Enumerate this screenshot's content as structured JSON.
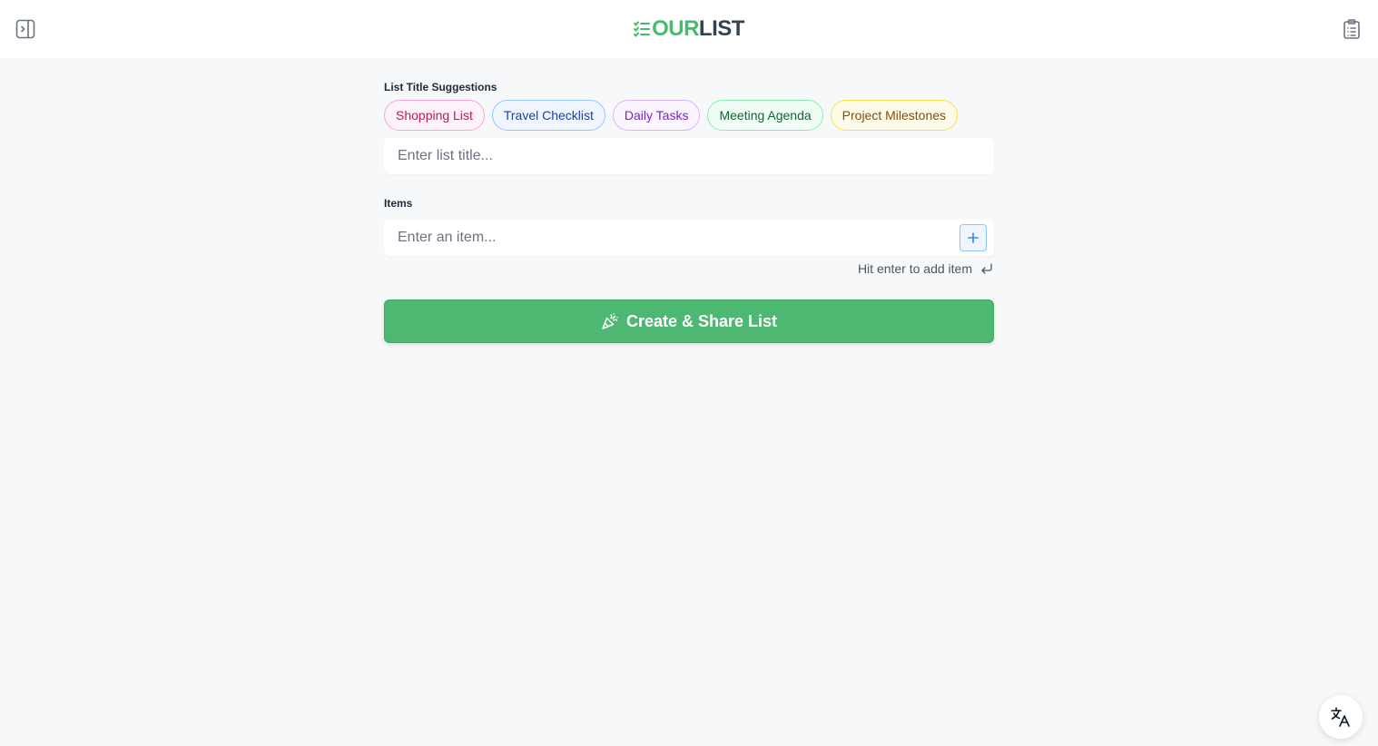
{
  "header": {
    "logo": {
      "part1": "OUR",
      "part2": "LIST",
      "mark_icon": "checklist-icon"
    },
    "left_icon": "sidebar-toggle-icon",
    "right_icon": "clipboard-list-icon"
  },
  "suggestions": {
    "label": "List Title Suggestions",
    "chips": [
      {
        "label": "Shopping List",
        "text_color": "#be185d",
        "bg": "#fdf2f8",
        "border": "#f9a8d4"
      },
      {
        "label": "Travel Checklist",
        "text_color": "#1e40af",
        "bg": "#eff6ff",
        "border": "#93c5fd"
      },
      {
        "label": "Daily Tasks",
        "text_color": "#7e22ce",
        "bg": "#faf5ff",
        "border": "#d8b4fe"
      },
      {
        "label": "Meeting Agenda",
        "text_color": "#166534",
        "bg": "#f0fdf4",
        "border": "#86efac"
      },
      {
        "label": "Project Milestones",
        "text_color": "#854d0e",
        "bg": "#fefce8",
        "border": "#fde047"
      }
    ]
  },
  "title_input": {
    "placeholder": "Enter list title...",
    "value": ""
  },
  "items": {
    "label": "Items",
    "input_placeholder": "Enter an item...",
    "input_value": "",
    "add_icon": "plus-icon",
    "hint": "Hit enter to add item",
    "hint_icon": "enter-key-icon"
  },
  "create_button": {
    "label": "Create & Share List",
    "icon": "party-popper-icon"
  },
  "translate_button": {
    "icon": "translate-icon"
  },
  "colors": {
    "brand_green": "#4cb871",
    "logo_dark": "#374151",
    "background": "#f7f8fa"
  }
}
